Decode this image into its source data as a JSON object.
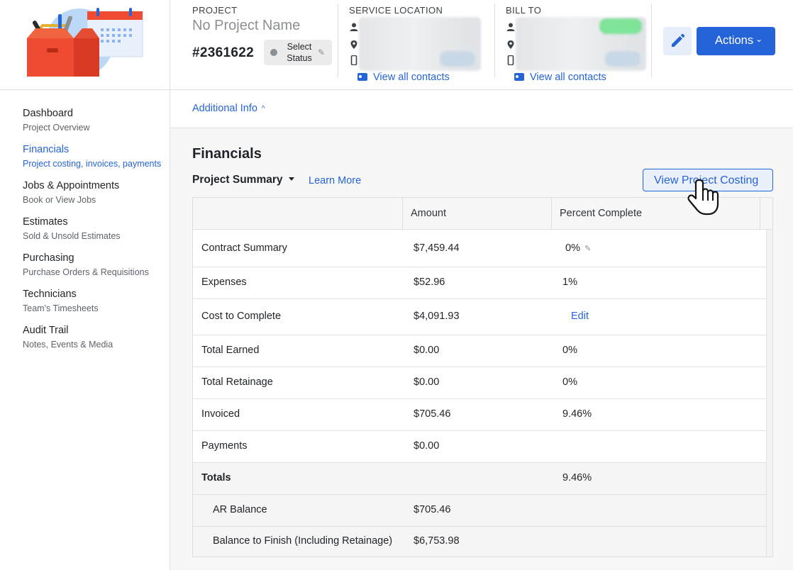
{
  "colors": {
    "accent": "#2563d8",
    "border": "#dcdfe3",
    "panel_bg": "#f7f7f8"
  },
  "header": {
    "project_label": "PROJECT",
    "project_name": "No Project Name",
    "project_number": "#2361622",
    "status_button": "Select Status",
    "service_location": {
      "label": "SERVICE LOCATION",
      "view_all": "View all contacts"
    },
    "bill_to": {
      "label": "BILL TO",
      "view_all": "View all contacts"
    },
    "actions_label": "Actions"
  },
  "sidebar": {
    "items": [
      {
        "title": "Dashboard",
        "subtitle": "Project Overview"
      },
      {
        "title": "Financials",
        "subtitle": "Project costing, invoices, payments",
        "active": true
      },
      {
        "title": "Jobs & Appointments",
        "subtitle": "Book or View Jobs"
      },
      {
        "title": "Estimates",
        "subtitle": "Sold & Unsold Estimates"
      },
      {
        "title": "Purchasing",
        "subtitle": "Purchase Orders & Requisitions"
      },
      {
        "title": "Technicians",
        "subtitle": "Team's Timesheets"
      },
      {
        "title": "Audit Trail",
        "subtitle": "Notes, Events & Media"
      }
    ]
  },
  "main": {
    "additional_info": "Additional Info",
    "section_title": "Financials",
    "summary_select": "Project Summary",
    "learn_more": "Learn More",
    "view_costing": "View Project Costing",
    "table": {
      "headers": [
        "",
        "Amount",
        "Percent Complete"
      ],
      "rows": [
        {
          "label": "Contract Summary",
          "amount": "$7,459.44",
          "percent": "0%"
        },
        {
          "label": "Expenses",
          "amount": "$52.96",
          "percent": "1%"
        },
        {
          "label": "Cost to Complete",
          "amount": "$4,091.93",
          "percent": "Edit"
        },
        {
          "label": "Total Earned",
          "amount": "$0.00",
          "percent": "0%"
        },
        {
          "label": "Total Retainage",
          "amount": "$0.00",
          "percent": "0%"
        },
        {
          "label": "Invoiced",
          "amount": "$705.46",
          "percent": "9.46%"
        },
        {
          "label": "Payments",
          "amount": "$0.00",
          "percent": ""
        },
        {
          "label": "Totals",
          "amount": "",
          "percent": "9.46%"
        },
        {
          "label": "AR Balance",
          "amount": "$705.46",
          "percent": ""
        },
        {
          "label": "Balance to Finish (Including Retainage)",
          "amount": "$6,753.98",
          "percent": ""
        }
      ]
    }
  }
}
